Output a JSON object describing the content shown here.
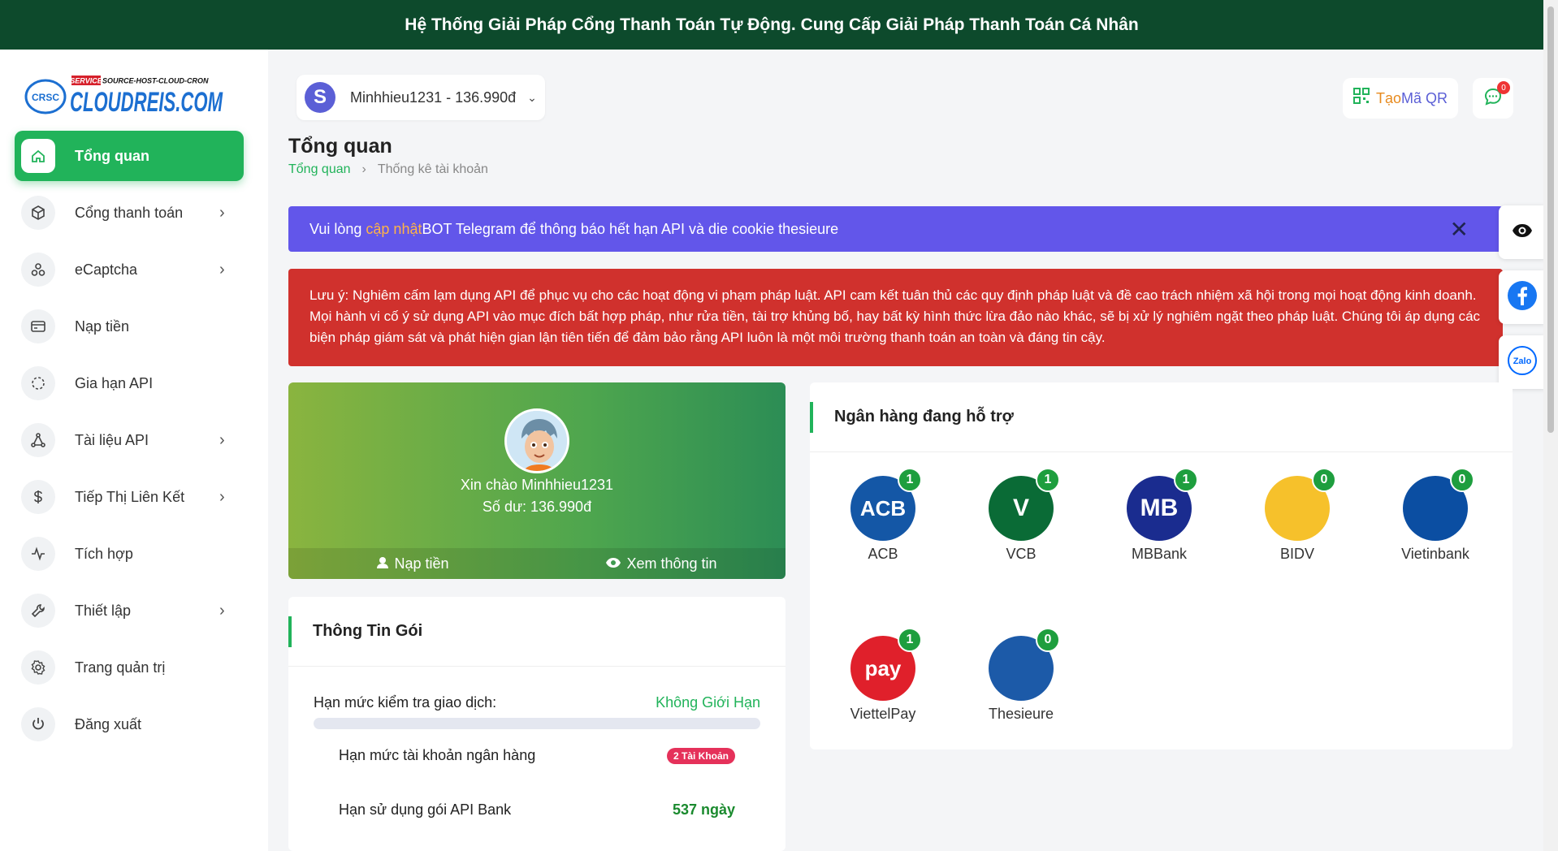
{
  "topbar": {
    "text": "Hệ Thống Giải Pháp Cổng Thanh Toán Tự Động. Cung Cấp Giải Pháp Thanh Toán Cá Nhân"
  },
  "logo": {
    "text": "CLOUDREIS.COM",
    "tag": "SERVICE",
    "tagline": "SOURCE-HOST-CLOUD-CRON",
    "mark": "CRSC"
  },
  "sidebar": {
    "items": [
      {
        "label": "Tổng quan",
        "icon": "home-icon",
        "active": true,
        "chevron": false
      },
      {
        "label": "Cổng thanh toán",
        "icon": "box-icon",
        "chevron": true
      },
      {
        "label": "eCaptcha",
        "icon": "shapes-icon",
        "chevron": true
      },
      {
        "label": "Nạp tiền",
        "icon": "credit-card-icon",
        "chevron": false
      },
      {
        "label": "Gia hạn API",
        "icon": "loader-icon",
        "chevron": false
      },
      {
        "label": "Tài liệu API",
        "icon": "network-icon",
        "chevron": true
      },
      {
        "label": "Tiếp Thị Liên Kết",
        "icon": "dollar-icon",
        "chevron": true
      },
      {
        "label": "Tích hợp",
        "icon": "activity-icon",
        "chevron": false
      },
      {
        "label": "Thiết lập",
        "icon": "wrench-icon",
        "chevron": true
      },
      {
        "label": "Trang quản trị",
        "icon": "settings-icon",
        "chevron": false
      },
      {
        "label": "Đăng xuất",
        "icon": "power-icon",
        "chevron": false
      }
    ]
  },
  "header": {
    "avatar_letter": "S",
    "user_balance": "Minhhieu1231 - 136.990đ",
    "qr_prefix": "Tạo",
    "qr_label": " Mã QR",
    "chat_count": "0"
  },
  "page": {
    "title": "Tổng quan",
    "breadcrumb": [
      "Tổng quan",
      "Thống kê tài khoản"
    ]
  },
  "alerts": {
    "blue_prefix": "Vui lòng ",
    "blue_highlight": "cập nhật",
    "blue_suffix": " BOT Telegram để thông báo hết hạn API và die cookie thesieure",
    "red": "Lưu ý: Nghiêm cấm lạm dụng API để phục vụ cho các hoạt động vi phạm pháp luật. API cam kết tuân thủ các quy định pháp luật và đề cao trách nhiệm xã hội trong mọi hoạt động kinh doanh. Mọi hành vi cố ý sử dụng API vào mục đích bất hợp pháp, như rửa tiền, tài trợ khủng bố, hay bất kỳ hình thức lừa đảo nào khác, sẽ bị xử lý nghiêm ngặt theo pháp luật. Chúng tôi áp dụng các biện pháp giám sát và phát hiện gian lận tiên tiến để đảm bảo rằng API luôn là một môi trường thanh toán an toàn và đáng tin cậy."
  },
  "welcome": {
    "greeting": "Xin chào Minhhieu1231",
    "balance": "Số dư: 136.990đ",
    "deposit": "Nạp tiền",
    "view_info": "Xem thông tin"
  },
  "package": {
    "title": "Thông Tin Gói",
    "check_limit_label": "Hạn mức kiểm tra giao dịch:",
    "check_limit_value": "Không Giới Hạn",
    "bank_limit_label": "Hạn mức tài khoản ngân hàng",
    "bank_limit_value": "2 Tài Khoản",
    "api_usage_label": "Hạn sử dụng gói API Bank",
    "api_usage_value": "537 ngày"
  },
  "banks": {
    "title": "Ngân hàng đang hỗ trợ",
    "list": [
      {
        "name": "ACB",
        "count": "1",
        "color": "#1457a6",
        "abbr": "ACB"
      },
      {
        "name": "VCB",
        "count": "1",
        "color": "#0a6b36",
        "abbr": "V"
      },
      {
        "name": "MBBank",
        "count": "1",
        "color": "#1a2c8f",
        "abbr": "MB"
      },
      {
        "name": "BIDV",
        "count": "0",
        "color": "#f6c12b",
        "abbr": ""
      },
      {
        "name": "Vietinbank",
        "count": "0",
        "color": "#0b4ea2",
        "abbr": ""
      },
      {
        "name": "ViettelPay",
        "count": "1",
        "color": "#e0202b",
        "abbr": "pay"
      },
      {
        "name": "Thesieure",
        "count": "0",
        "color": "#1c5aa8",
        "abbr": ""
      }
    ]
  },
  "floating": [
    "eye-icon",
    "facebook-icon",
    "zalo-icon"
  ],
  "floating_zalo": "Zalo"
}
